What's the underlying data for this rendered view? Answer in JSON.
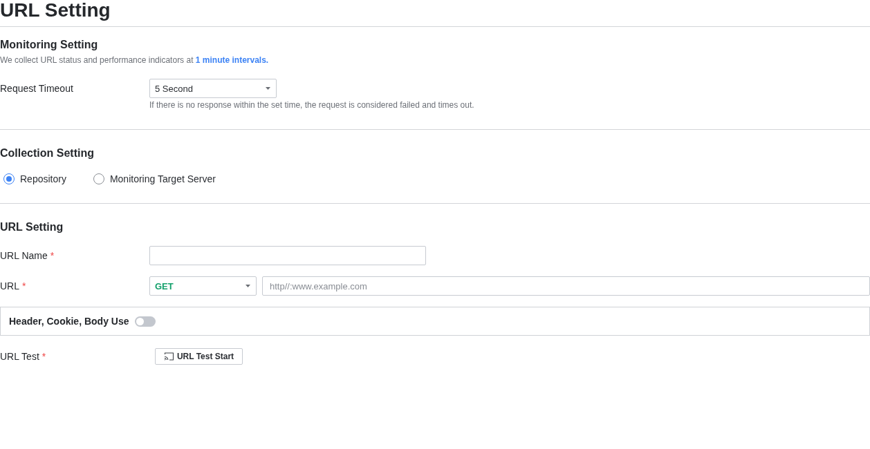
{
  "title": "URL Setting",
  "monitoring_setting": {
    "heading": "Monitoring Setting",
    "description": "We collect URL status and performance indicators at **1 minute intervals.**",
    "request_timeout": {
      "label": "Request Timeout",
      "value": "5 Second",
      "help": "If there is no response within the set time, the request is considered failed and times out."
    }
  },
  "collection_setting": {
    "heading": "Collection Setting",
    "options": [
      {
        "label": "Repository",
        "selected": true
      },
      {
        "label": "Monitoring Target Server",
        "selected": false
      }
    ]
  },
  "url_setting": {
    "heading": "URL Setting",
    "url_name": {
      "label": "URL Name",
      "required_mark": "*"
    },
    "url": {
      "label": "URL",
      "required_mark": "*",
      "method": "GET",
      "placeholder": "http//:www.example.com"
    },
    "header_cookie_body": {
      "label": "Header, Cookie, Body Use",
      "on": false
    },
    "url_test": {
      "label": "URL Test",
      "required_mark": "*",
      "button": "URL Test Start"
    }
  }
}
